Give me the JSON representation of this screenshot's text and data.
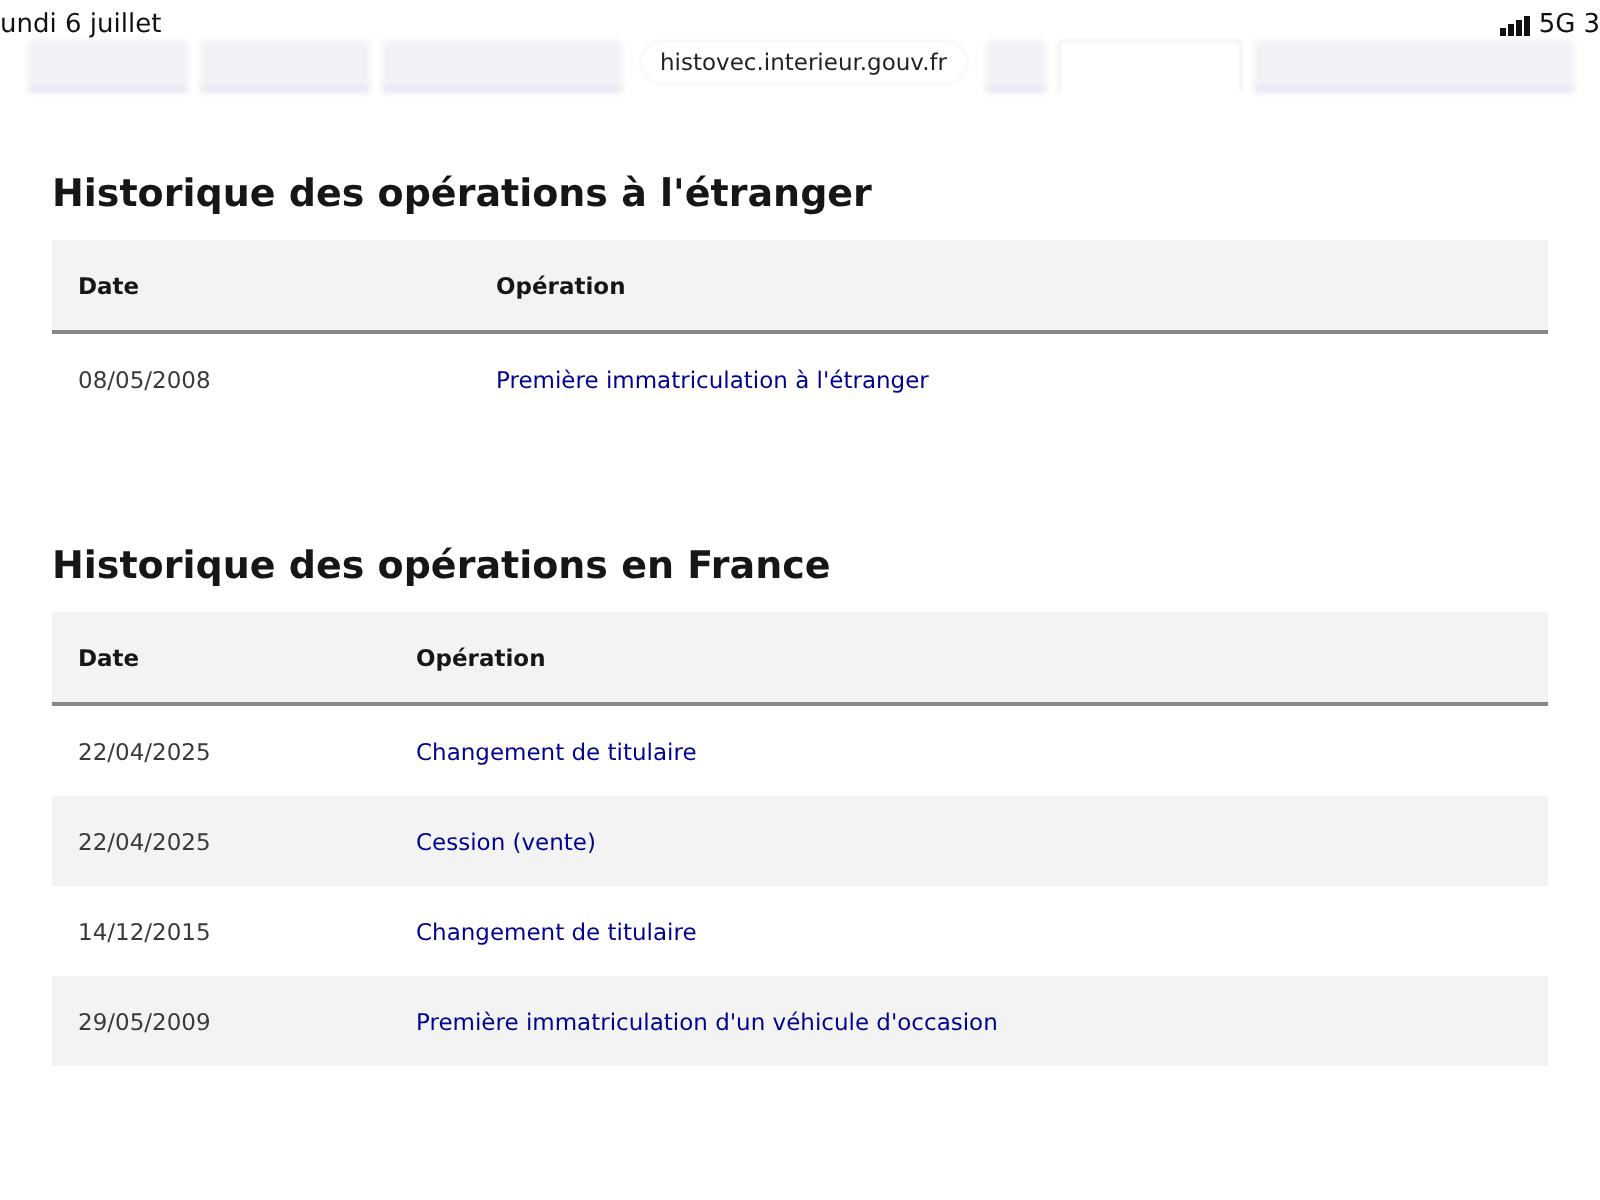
{
  "status_bar": {
    "date": "undi 6 juillet",
    "network": "5G",
    "battery": "3"
  },
  "url": "histovec.interieur.gouv.fr",
  "tabs": [
    {
      "selected": false
    },
    {
      "selected": false
    },
    {
      "selected": false
    },
    {
      "selected": false
    },
    {
      "selected": true
    },
    {
      "selected": false
    }
  ],
  "sections": [
    {
      "title": "Historique des opérations à l'étranger",
      "columns": [
        "Date",
        "Opération"
      ],
      "rows": [
        {
          "date": "08/05/2008",
          "operation": "Première immatriculation à l'étranger"
        }
      ]
    },
    {
      "title": "Historique des opérations en France",
      "columns": [
        "Date",
        "Opération"
      ],
      "rows": [
        {
          "date": "22/04/2025",
          "operation": "Changement de titulaire"
        },
        {
          "date": "22/04/2025",
          "operation": "Cession (vente)"
        },
        {
          "date": "14/12/2015",
          "operation": "Changement de titulaire"
        },
        {
          "date": "29/05/2009",
          "operation": "Première immatriculation d'un véhicule d'occasion"
        }
      ]
    }
  ]
}
